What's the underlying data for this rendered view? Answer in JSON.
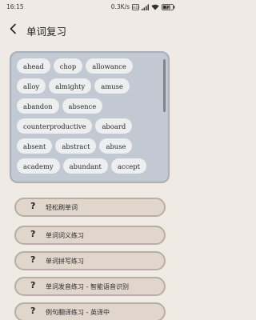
{
  "status": {
    "time": "16:15",
    "network_speed": "0.3K/s",
    "battery_level": "72"
  },
  "header": {
    "title": "单词复习"
  },
  "words": [
    "ahead",
    "chop",
    "allowance",
    "alloy",
    "almighty",
    "amuse",
    "abandon",
    "absence",
    "counterproductive",
    "aboard",
    "absent",
    "abstract",
    "abuse",
    "academy",
    "abundant",
    "accept"
  ],
  "practice": {
    "icon_glyph": "?",
    "items": [
      "轻松刷单词",
      "单词词义练习",
      "单词拼写练习",
      "单词发音练习 - 智能语音识别",
      "例句翻译练习 - 英译中"
    ]
  }
}
